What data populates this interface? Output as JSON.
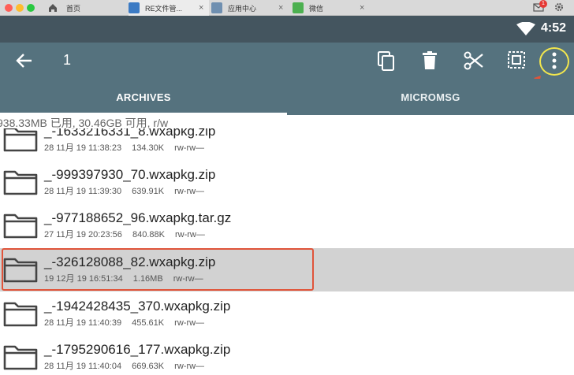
{
  "host": {
    "tabs": [
      {
        "label": "首页"
      },
      {
        "label": "RE文件管..."
      },
      {
        "label": "应用中心"
      },
      {
        "label": "微信"
      }
    ],
    "notification_count": "1"
  },
  "status": {
    "time": "4:52"
  },
  "actionbar": {
    "selected_count": "1",
    "icons": [
      "back-arrow-icon",
      "copy-icon",
      "delete-icon",
      "cut-icon",
      "select-all-icon",
      "more-vert-icon"
    ]
  },
  "tabs": [
    {
      "label": "ARCHIVES",
      "active": true
    },
    {
      "label": "MICROMSG",
      "active": false
    }
  ],
  "storage_info": "938.33MB 已用, 30.46GB 可用, r/w",
  "files": [
    {
      "name": "_-1633216331_8.wxapkg.zip",
      "date": "28 11月 19 11:38:23",
      "size": "134.30K",
      "perm": "rw-rw—",
      "selected": false
    },
    {
      "name": "_-999397930_70.wxapkg.zip",
      "date": "28 11月 19 11:39:30",
      "size": "639.91K",
      "perm": "rw-rw—",
      "selected": false
    },
    {
      "name": "_-977188652_96.wxapkg.tar.gz",
      "date": "27 11月 19 20:23:56",
      "size": "840.88K",
      "perm": "rw-rw—",
      "selected": false
    },
    {
      "name": "_-326128088_82.wxapkg.zip",
      "date": "19 12月 19 16:51:34",
      "size": "1.16MB",
      "perm": "rw-rw—",
      "selected": true
    },
    {
      "name": "_-1942428435_370.wxapkg.zip",
      "date": "28 11月 19 11:40:39",
      "size": "455.61K",
      "perm": "rw-rw—",
      "selected": false
    },
    {
      "name": "_-1795290616_177.wxapkg.zip",
      "date": "28 11月 19 11:40:04",
      "size": "669.63K",
      "perm": "rw-rw—",
      "selected": false
    }
  ],
  "colors": {
    "toolbar": "#55727e",
    "statusbar": "#44555f",
    "selected_row": "#d2d2d2",
    "annotation_box": "#e0543a",
    "annotation_circle": "#f2e64d"
  }
}
